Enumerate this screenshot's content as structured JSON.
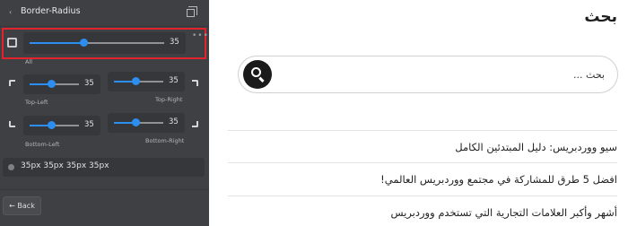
{
  "editor": {
    "title": "Border-Radius",
    "all": {
      "label": "All",
      "value": "35",
      "level": 0.35
    },
    "corners": {
      "top_left": {
        "label": "Top-Left",
        "value": "35",
        "level": 0.35
      },
      "top_right": {
        "label": "Top-Right",
        "value": "35",
        "level": 0.35
      },
      "bottom_left": {
        "label": "Bottom-Left",
        "value": "35",
        "level": 0.35
      },
      "bottom_right": {
        "label": "Bottom-Right",
        "value": "35",
        "level": 0.35
      }
    },
    "summary": "35px  35px  35px  35px",
    "back_label": "← Back",
    "accent_color": "#2b8ef0",
    "highlight_color": "#e2232b",
    "icons": [
      "chevron-left-icon",
      "copy-icon",
      "more-dots-icon",
      "link-corners-icon",
      "corner-icons",
      "radius-icon"
    ]
  },
  "preview": {
    "title": "بحث",
    "search": {
      "placeholder": "بحث ...",
      "value": ""
    },
    "posts": [
      "سيو ووردبريس: دليل المبتدئين الكامل",
      "افضل 5 طرق للمشاركة في مجتمع ووردبريس العالمي!",
      "أشهر وأكبر العلامات التجارية التي تستخدم ووردبريس"
    ]
  }
}
